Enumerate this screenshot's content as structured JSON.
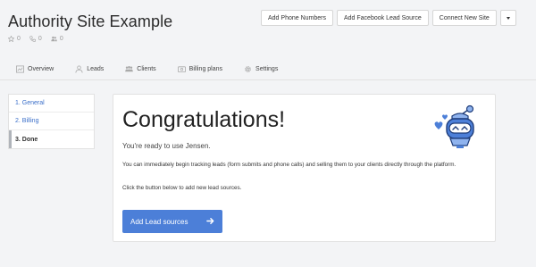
{
  "header": {
    "title": "Authority Site Example",
    "stats": [
      {
        "icon": "star-icon",
        "value": "0"
      },
      {
        "icon": "phone-icon",
        "value": "0"
      },
      {
        "icon": "users-icon",
        "value": "0"
      }
    ],
    "actions": {
      "add_phone": "Add Phone Numbers",
      "add_facebook": "Add Facebook Lead Source",
      "connect_site": "Connect New Site"
    }
  },
  "tabs": [
    {
      "label": "Overview",
      "icon": "chart-icon"
    },
    {
      "label": "Leads",
      "icon": "person-icon"
    },
    {
      "label": "Clients",
      "icon": "group-icon"
    },
    {
      "label": "Billing plans",
      "icon": "card-icon"
    },
    {
      "label": "Settings",
      "icon": "gear-icon"
    }
  ],
  "steps": [
    {
      "label": "1. General",
      "state": "link"
    },
    {
      "label": "2. Billing",
      "state": "link"
    },
    {
      "label": "3. Done",
      "state": "active"
    }
  ],
  "main": {
    "title": "Congratulations!",
    "subtitle": "You're ready to use Jensen.",
    "body": "You can immediately begin tracking leads (form submits and phone calls) and selling them to your clients directly through the platform.",
    "instruction": "Click the button below to add new lead sources.",
    "cta_label": "Add Lead sources"
  },
  "colors": {
    "accent": "#4c7fd8",
    "link": "#3b6fc9",
    "background": "#f3f4f6"
  }
}
